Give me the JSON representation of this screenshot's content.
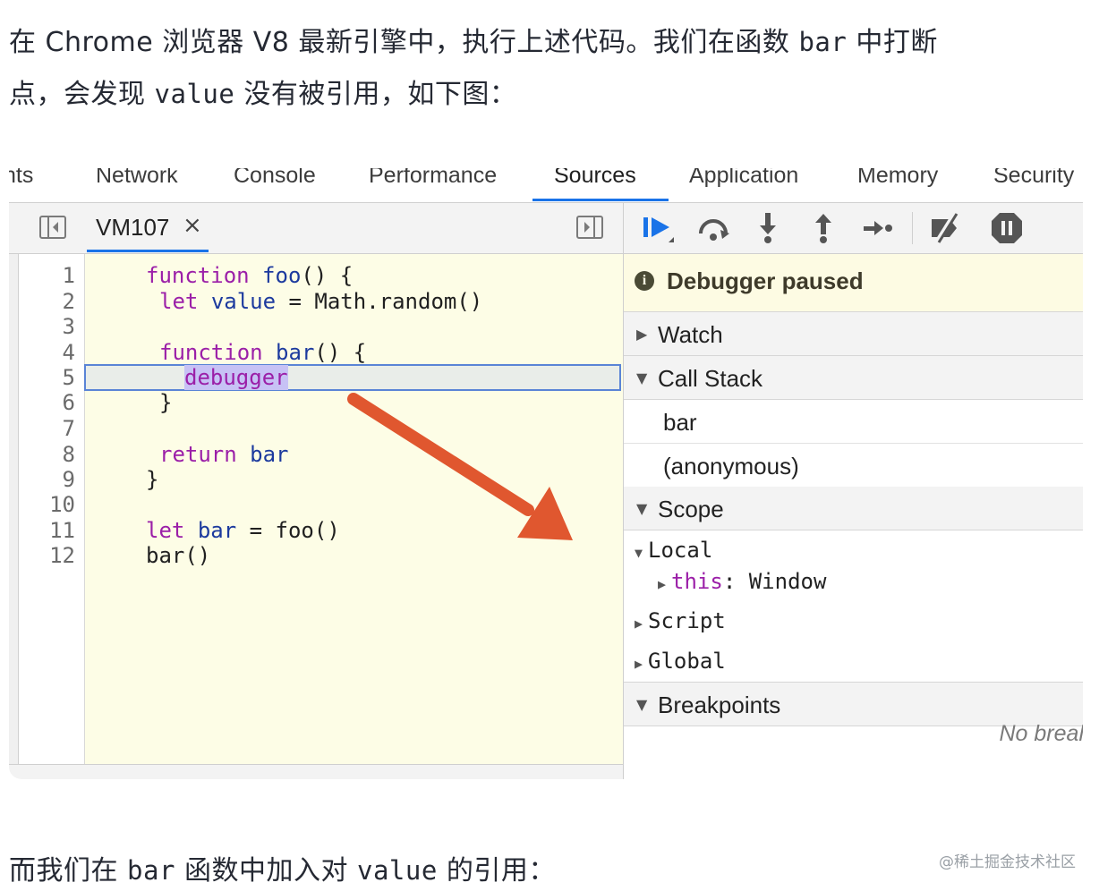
{
  "article": {
    "p1_a": "在 Chrome 浏览器 V8 最新引擎中，执行上述代码。我们在函数 ",
    "p1_code": "bar",
    "p1_b": " 中打断",
    "p2_a": "点，会发现 ",
    "p2_code": "value",
    "p2_b": " 没有被引用，如下图：",
    "p3_a": "而我们在 ",
    "p3_code1": "bar",
    "p3_b": " 函数中加入对 ",
    "p3_code2": "value",
    "p3_c": " 的引用：",
    "watermark": "@稀土掘金技术社区"
  },
  "devtools": {
    "tabs": [
      "nts",
      "Network",
      "Console",
      "Performance",
      "Sources",
      "Application",
      "Memory",
      "Security"
    ],
    "active_tab": "Sources",
    "file_tab": "VM107",
    "file_close": "×",
    "line_numbers": [
      "1",
      "2",
      "3",
      "4",
      "5",
      "6",
      "7",
      "8",
      "9",
      "10",
      "11",
      "12"
    ],
    "code": {
      "l1_kw": "function",
      "l1_fn": "foo",
      "l1_rest": "() {",
      "l2_kw": "let",
      "l2_fn": "value",
      "l2_rest": " = Math.random()",
      "l4_kw": "function",
      "l4_fn": "bar",
      "l4_rest": "() {",
      "l5_kw": "debugger",
      "l6": "}",
      "l8_kw": "return",
      "l8_fn": "bar",
      "l9": "}",
      "l11_kw": "let",
      "l11_fn": "bar",
      "l11_rest": " = foo()",
      "l12": "bar()"
    },
    "paused_text": "Debugger paused",
    "info_icon": "i",
    "sections": {
      "watch": "Watch",
      "call_stack": "Call Stack",
      "scope": "Scope",
      "breakpoints": "Breakpoints"
    },
    "call_stack": [
      "bar",
      "(anonymous)"
    ],
    "scope": {
      "local": "Local",
      "this_key": "this",
      "this_val": ": Window",
      "script": "Script",
      "global": "Global"
    },
    "no_breakpoints": "No breal",
    "colors": {
      "accent": "#1a73e8",
      "arrow": "#e0572f",
      "editor_bg": "#fdfde6",
      "paused_bg": "#fdfbe3"
    }
  }
}
